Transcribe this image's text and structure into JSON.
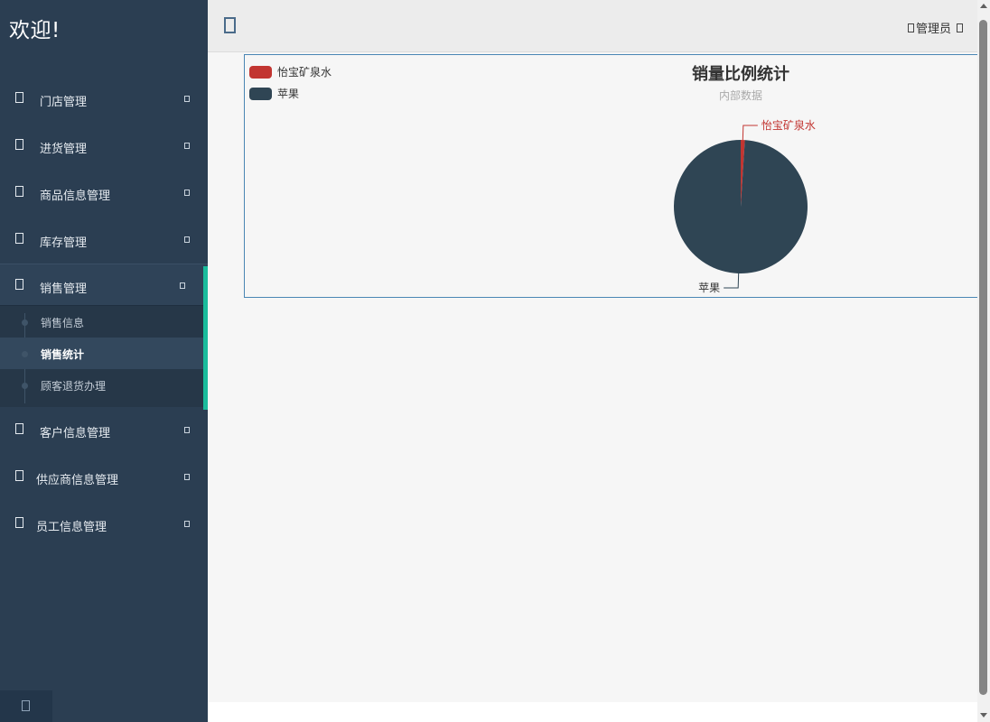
{
  "app": {
    "brand": "欢迎!"
  },
  "header": {
    "user_label": "管理员"
  },
  "sidebar": {
    "items": [
      {
        "label": "门店管理"
      },
      {
        "label": "进货管理"
      },
      {
        "label": "商品信息管理"
      },
      {
        "label": "库存管理"
      },
      {
        "label": "销售管理",
        "open": true,
        "children": [
          "销售信息",
          "销售统计",
          "顾客退货办理"
        ]
      },
      {
        "label": "客户信息管理"
      },
      {
        "label": "供应商信息管理"
      },
      {
        "label": "员工信息管理"
      }
    ],
    "active_child": "销售统计"
  },
  "colors": {
    "sidebar": "#2b3e52",
    "accent": "#1abc9c",
    "series_1": "#c23531",
    "series_2": "#2f4554"
  },
  "chart_data": {
    "type": "pie",
    "title": "销量比例统计",
    "subtitle": "内部数据",
    "legend_position": "top-left",
    "series": [
      {
        "name": "怡宝矿泉水",
        "value": 1,
        "color": "#c23531"
      },
      {
        "name": "苹果",
        "value": 99,
        "color": "#2f4554"
      }
    ]
  }
}
